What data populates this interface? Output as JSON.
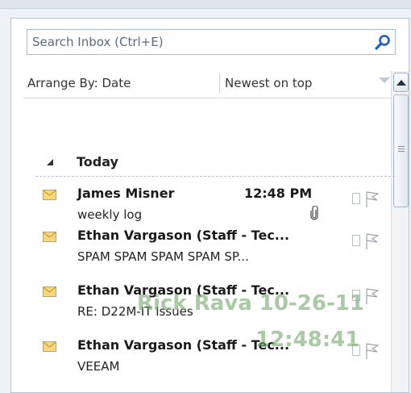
{
  "search": {
    "placeholder": "Search Inbox (Ctrl+E)",
    "value": ""
  },
  "arrange": {
    "by_label": "Arrange By: Date",
    "order_label": "Newest on top"
  },
  "group": {
    "label": "Today"
  },
  "messages": [
    {
      "sender": "James Misner",
      "time": "12:48 PM",
      "subject": "weekly log",
      "has_attachment": true
    },
    {
      "sender": "Ethan Vargason (Staff - Tec...",
      "time": "",
      "subject": "SPAM SPAM SPAM SPAM SP...",
      "has_attachment": false
    },
    {
      "sender": "Ethan Vargason (Staff - Tec...",
      "time": "",
      "subject": "RE: D22M-IT Issues",
      "has_attachment": false
    },
    {
      "sender": "Ethan Vargason (Staff - Tec...",
      "time": "",
      "subject": "VEEAM",
      "has_attachment": false
    }
  ],
  "watermark": {
    "line1": "Rick Rava 10-26-11",
    "line2": "12:48:41"
  },
  "icons": {
    "search": "search-icon",
    "envelope": "envelope-icon",
    "attachment": "paperclip-icon",
    "flag": "flag-icon",
    "category": "category-box-icon",
    "collapse": "collapse-triangle-icon"
  },
  "colors": {
    "envelope": "#f2c44f",
    "search_icon": "#1f5fb8",
    "border": "#b9c8d8",
    "watermark": "#76a86e"
  }
}
